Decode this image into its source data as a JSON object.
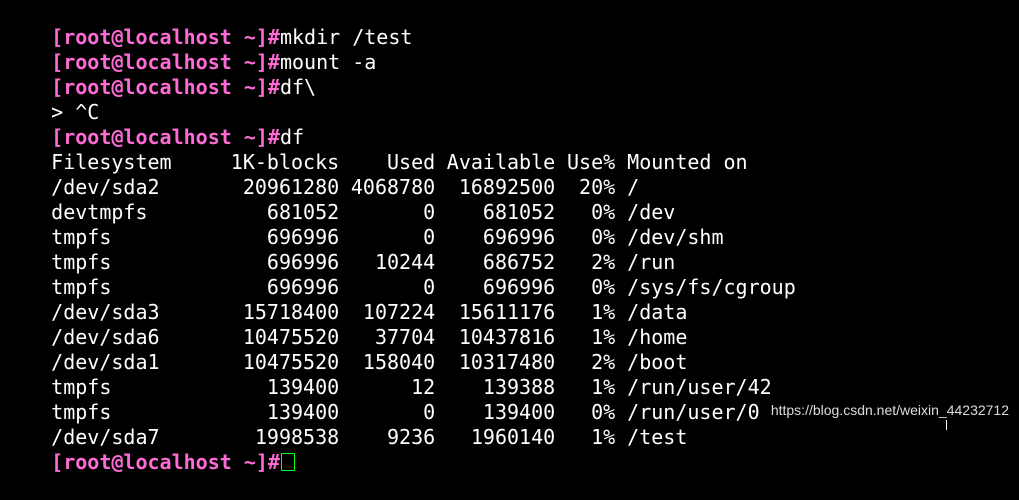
{
  "terminal": {
    "prompt": "[root@localhost ~]#",
    "commands": [
      "mkdir /test",
      "mount -a",
      "df\\"
    ],
    "continuation": "> ^C",
    "last_command": "df",
    "header": {
      "filesystem": "Filesystem",
      "blocks": "1K-blocks",
      "used": "Used",
      "available": "Available",
      "use": "Use%",
      "mounted": "Mounted on"
    },
    "rows": [
      {
        "fs": "/dev/sda2",
        "blocks": "20961280",
        "used": "4068780",
        "avail": "16892500",
        "use": "20%",
        "mount": "/"
      },
      {
        "fs": "devtmpfs",
        "blocks": "681052",
        "used": "0",
        "avail": "681052",
        "use": "0%",
        "mount": "/dev"
      },
      {
        "fs": "tmpfs",
        "blocks": "696996",
        "used": "0",
        "avail": "696996",
        "use": "0%",
        "mount": "/dev/shm"
      },
      {
        "fs": "tmpfs",
        "blocks": "696996",
        "used": "10244",
        "avail": "686752",
        "use": "2%",
        "mount": "/run"
      },
      {
        "fs": "tmpfs",
        "blocks": "696996",
        "used": "0",
        "avail": "696996",
        "use": "0%",
        "mount": "/sys/fs/cgroup"
      },
      {
        "fs": "/dev/sda3",
        "blocks": "15718400",
        "used": "107224",
        "avail": "15611176",
        "use": "1%",
        "mount": "/data"
      },
      {
        "fs": "/dev/sda6",
        "blocks": "10475520",
        "used": "37704",
        "avail": "10437816",
        "use": "1%",
        "mount": "/home"
      },
      {
        "fs": "/dev/sda1",
        "blocks": "10475520",
        "used": "158040",
        "avail": "10317480",
        "use": "2%",
        "mount": "/boot"
      },
      {
        "fs": "tmpfs",
        "blocks": "139400",
        "used": "12",
        "avail": "139388",
        "use": "1%",
        "mount": "/run/user/42"
      },
      {
        "fs": "tmpfs",
        "blocks": "139400",
        "used": "0",
        "avail": "139400",
        "use": "0%",
        "mount": "/run/user/0"
      },
      {
        "fs": "/dev/sda7",
        "blocks": "1998538",
        "used": "9236",
        "avail": "1960140",
        "use": "1%",
        "mount": "/test"
      }
    ],
    "final_prompt": "[root@localhost ~]#"
  },
  "watermark": "https://blog.csdn.net/weixin_44232712",
  "colors": {
    "background": "#000000",
    "prompt": "#ff6bd6",
    "text": "#ffffff",
    "cursor": "#00ff00"
  }
}
